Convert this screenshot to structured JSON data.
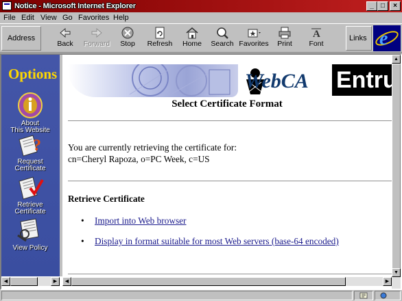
{
  "window": {
    "title": "Notice - Microsoft Internet Explorer",
    "minimize": "_",
    "maximize": "□",
    "close": "×"
  },
  "menu": [
    "File",
    "Edit",
    "View",
    "Go",
    "Favorites",
    "Help"
  ],
  "toolbar": {
    "address_label": "Address",
    "buttons": [
      {
        "label": "Back",
        "icon": "back-arrow-icon"
      },
      {
        "label": "Forward",
        "icon": "forward-arrow-icon",
        "disabled": true
      },
      {
        "label": "Stop",
        "icon": "stop-icon"
      },
      {
        "label": "Refresh",
        "icon": "refresh-icon"
      },
      {
        "label": "Home",
        "icon": "home-icon"
      },
      {
        "label": "Search",
        "icon": "search-icon"
      },
      {
        "label": "Favorites",
        "icon": "favorites-icon"
      },
      {
        "label": "Print",
        "icon": "print-icon"
      },
      {
        "label": "Font",
        "icon": "font-icon"
      }
    ],
    "links_label": "Links"
  },
  "sidebar": {
    "title": "Options",
    "items": [
      {
        "label_line1": "About",
        "label_line2": "This Website",
        "icon": "info-icon"
      },
      {
        "label_line1": "Request",
        "label_line2": "Certificate",
        "icon": "request-certificate-icon"
      },
      {
        "label_line1": "Retrieve",
        "label_line2": "Certificate",
        "icon": "retrieve-certificate-icon"
      },
      {
        "label_line1": "View Policy",
        "label_line2": "",
        "icon": "view-policy-icon"
      }
    ]
  },
  "banner": {
    "webca": "WebCA",
    "entrust": "Entru"
  },
  "main": {
    "heading": "Select Certificate Format",
    "retrieving_text": "You are currently retrieving the certificate for:",
    "subject": "cn=Cheryl Rapoza, o=PC Week, c=US",
    "section_title": "Retrieve Certificate",
    "links": [
      "Import into Web browser",
      "Display in format suitable for most Web servers (base-64 encoded)"
    ],
    "bullet": "•"
  },
  "colors": {
    "sidebar_bg": "#3a4ea0",
    "options_title": "#ffd800",
    "link": "#1a1a8c"
  }
}
